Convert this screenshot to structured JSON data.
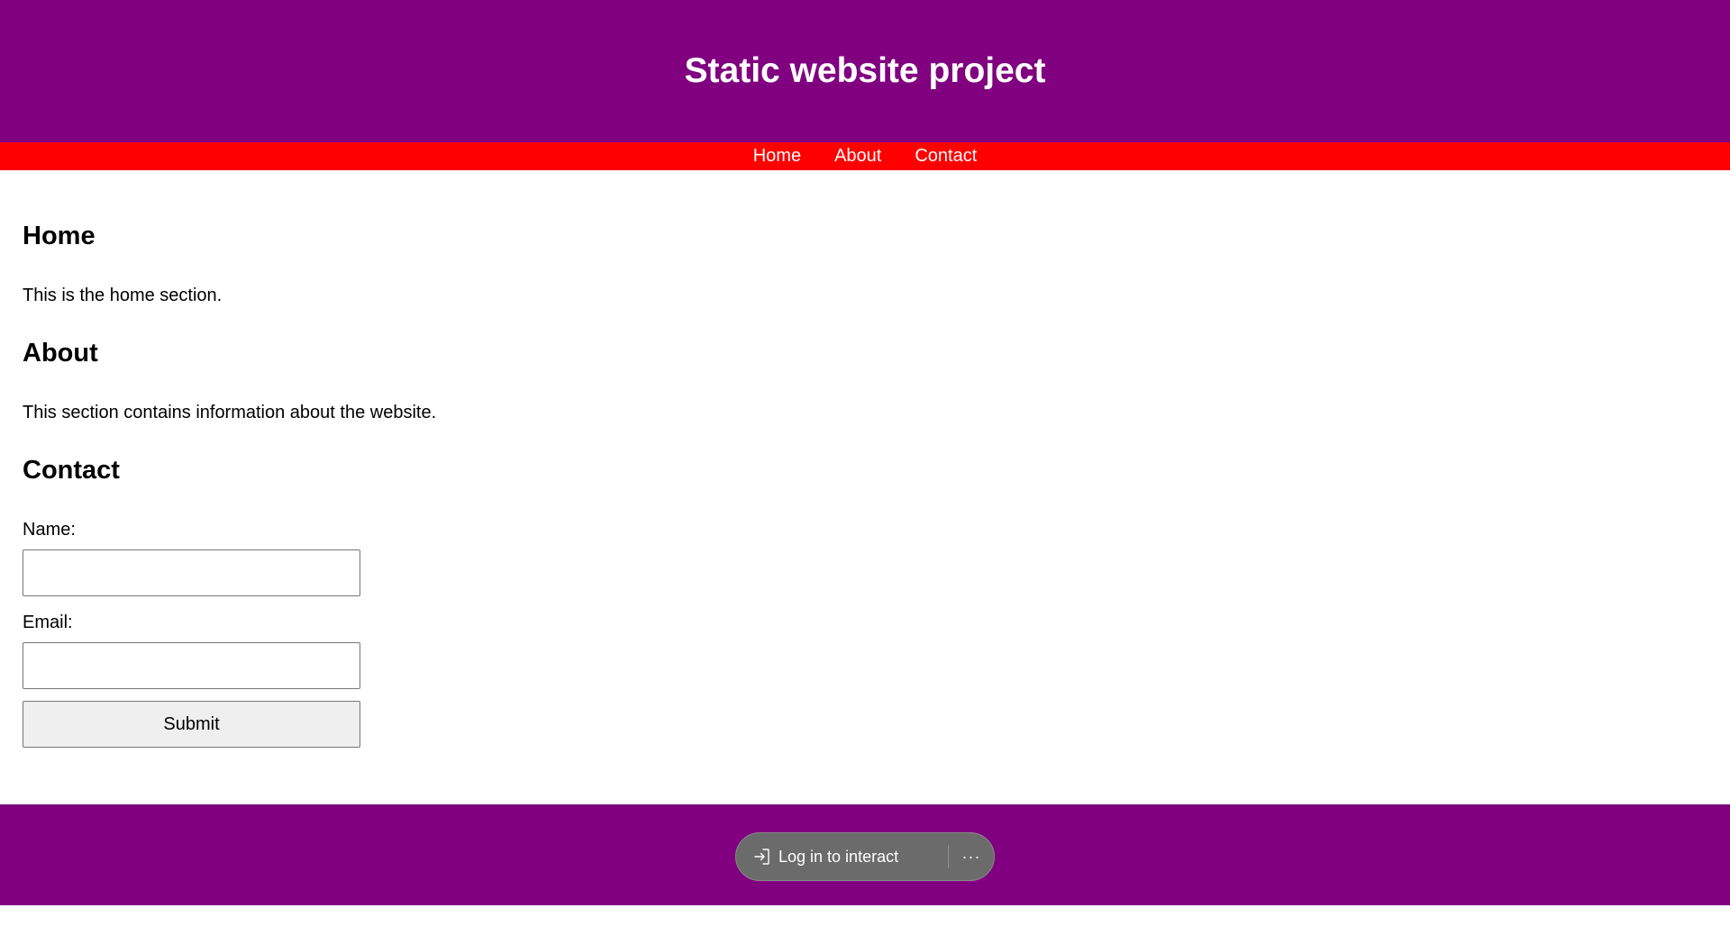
{
  "header": {
    "title": "Static website project"
  },
  "nav": {
    "items": [
      {
        "label": "Home"
      },
      {
        "label": "About"
      },
      {
        "label": "Contact"
      }
    ]
  },
  "home": {
    "heading": "Home",
    "text": "This is the home section."
  },
  "about": {
    "heading": "About",
    "text": "This section contains information about the website."
  },
  "contact": {
    "heading": "Contact",
    "name_label": "Name:",
    "name_value": "",
    "email_label": "Email:",
    "email_value": "",
    "submit_label": "Submit"
  },
  "footer": {
    "login_label": "Log in to interact",
    "login_icon": "login-arrow-icon",
    "more_label": "···",
    "more_icon": "more-icon"
  },
  "colors": {
    "header_bg": "#800080",
    "nav_bg": "#ff0000",
    "footer_bg": "#800080",
    "pill_bg": "#6b6b6b"
  }
}
